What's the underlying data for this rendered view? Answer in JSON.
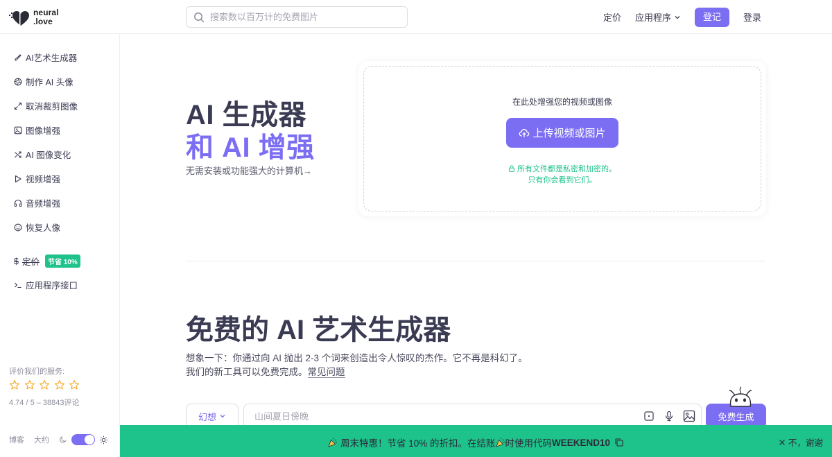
{
  "header": {
    "logo_line1": "neural",
    "logo_line2": ".love",
    "search_placeholder": "搜索数以百万计的免费图片",
    "nav": {
      "pricing": "定价",
      "apps": "应用程序",
      "signup": "登记",
      "login": "登录"
    }
  },
  "sidebar": {
    "items": [
      {
        "label": "AI艺术生成器",
        "icon": "brush-icon"
      },
      {
        "label": "制作 AI 头像",
        "icon": "aperture-icon"
      },
      {
        "label": "取消裁剪图像",
        "icon": "expand-icon"
      },
      {
        "label": "图像增强",
        "icon": "image-icon"
      },
      {
        "label": "AI 图像变化",
        "icon": "shuffle-icon"
      },
      {
        "label": "视频增强",
        "icon": "play-icon"
      },
      {
        "label": "音频增强",
        "icon": "headphones-icon"
      },
      {
        "label": "恢复人像",
        "icon": "smile-icon"
      }
    ],
    "pricing_label": "定价",
    "pricing_symbol": "$",
    "pricing_badge": "节省 10%",
    "api_label": "应用程序接口",
    "rate_label": "评价我们的服务:",
    "rating_score": "4.74 / 5 – 38843评论",
    "footer_blog": "博客",
    "footer_about": "大约"
  },
  "hero": {
    "title_line1": "AI 生成器",
    "title_line2": "和 AI 增强",
    "subtitle": "无需安装或功能强大的计算机→",
    "upload_hint": "在此处增强您的视频或图像",
    "upload_button": "上传视频或图片",
    "privacy_line1": "所有文件都是私密和加密的。",
    "privacy_line2": "只有你会看到它们。"
  },
  "art": {
    "title": "免费的 AI 艺术生成器",
    "desc_line1": "想象一下：你通过向 AI 抛出 2-3 个词来创造出令人惊叹的杰作。它不再是科幻了。",
    "desc_line2": "我们的新工具可以免费完成。",
    "faq_link": "常见问题",
    "style_label": "幻想",
    "prompt_placeholder": "山间夏日傍晚",
    "generate_button": "免费生成"
  },
  "promo": {
    "text_part1": "周末特惠！节省 10% 的折扣。在结账",
    "text_part2": "时使用代码",
    "code": "WEEKEND10",
    "dismiss": "不，谢谢"
  },
  "colors": {
    "accent": "#7c6ef2",
    "green": "#1ec28b",
    "text": "#3a3a52"
  }
}
